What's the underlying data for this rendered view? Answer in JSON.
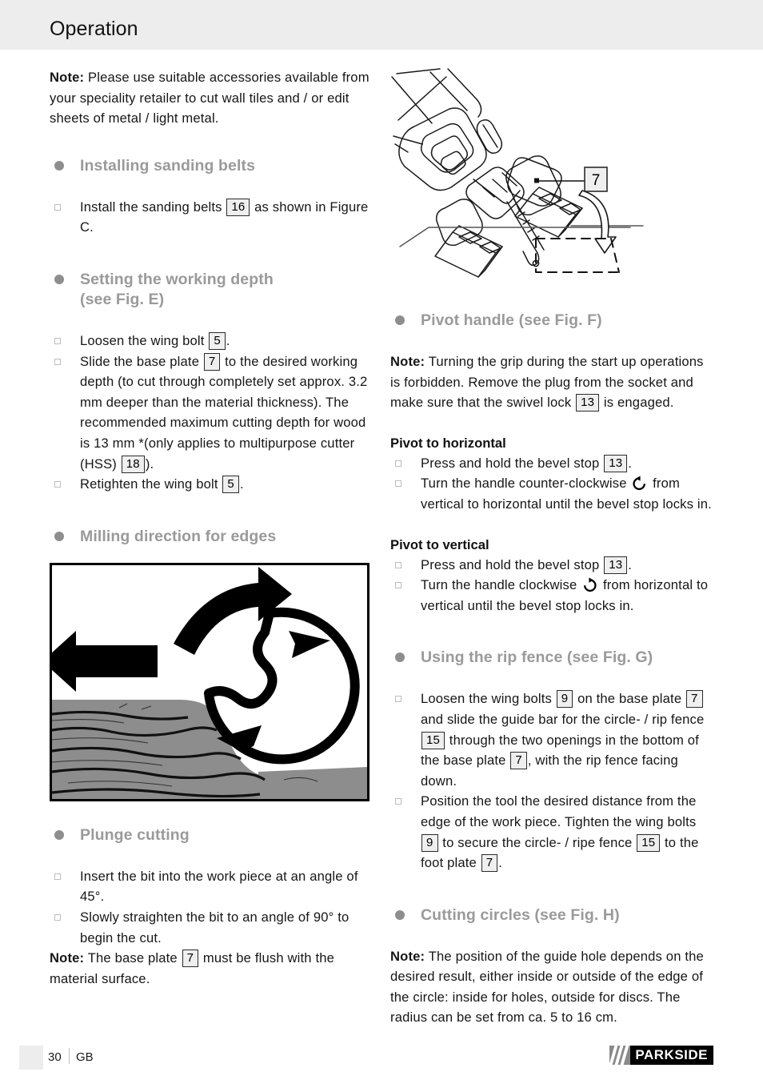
{
  "header": {
    "title": "Operation"
  },
  "colors": {
    "header_band": "#ededed",
    "heading_gray": "#9a9a9a",
    "bullet_gray": "#8e8e8e",
    "ref_box_fill": "#efefef",
    "logo_black": "#000000",
    "logo_gray": "#8a8a8a"
  },
  "left_column": {
    "intro_note": {
      "lead": "Note:",
      "text": " Please use suitable accessories available from your speciality retailer to cut wall tiles and / or edit sheets of metal / light metal."
    },
    "section_installing": {
      "heading": "Installing sanding belts",
      "items": [
        {
          "pre": "Install the sanding belts ",
          "ref": "16",
          "post": " as shown in Figure C."
        }
      ]
    },
    "section_depth": {
      "heading_line1": "Setting the working depth",
      "heading_line2": "(see Fig. E)",
      "items": [
        {
          "pre": "Loosen the wing bolt ",
          "ref": "5",
          "post": "."
        },
        {
          "pre": "Slide the base plate ",
          "ref": "7",
          "mid": " to the desired working depth (to cut through completely set approx. 3.2 mm deeper than the material thickness). The recommended maximum cutting depth for wood is 13 mm *(only applies to multipurpose cutter (HSS) ",
          "ref2": "18",
          "post": ")."
        },
        {
          "pre": "Retighten the wing bolt ",
          "ref": "5",
          "post": "."
        }
      ]
    },
    "section_milling": {
      "heading": "Milling direction for edges",
      "figure_name": "milling-direction-diagram",
      "figure_description": "Wood workpiece with feed arrow pointing left and a rotating cutter with curved clockwise arrows"
    },
    "section_plunge": {
      "heading": "Plunge cutting",
      "items": [
        {
          "text": "Insert the bit into the work piece at an angle of 45°."
        },
        {
          "text": "Slowly straighten the bit to an angle of 90° to begin the cut."
        }
      ],
      "note": {
        "lead": "Note:",
        "pre": " The base plate ",
        "ref": "7",
        "post": " must be flush with the material surface."
      }
    }
  },
  "right_column": {
    "figure_top": {
      "figure_name": "tool-base-plate-diagram",
      "callout": "7",
      "description": "Line drawing of the power tool tilted with base plate callout 7 and a curved down arrow to a dashed outline"
    },
    "section_pivot": {
      "heading": "Pivot handle (see Fig. F)",
      "note": {
        "lead": "Note:",
        "pre": " Turning the grip during the start up operations is forbidden. Remove the plug from the socket and make sure that the swivel lock ",
        "ref": "13",
        "post": " is engaged."
      },
      "horizontal": {
        "subhead": "Pivot to horizontal",
        "items": [
          {
            "pre": "Press and hold the bevel stop ",
            "ref": "13",
            "post": "."
          },
          {
            "pre": "Turn the handle counter-clockwise ",
            "icon": "rotate-counter-clockwise-icon",
            "post": " from vertical to horizontal until the bevel stop locks in."
          }
        ]
      },
      "vertical": {
        "subhead": "Pivot to vertical",
        "items": [
          {
            "pre": "Press and hold the bevel stop ",
            "ref": "13",
            "post": "."
          },
          {
            "pre": "Turn the handle clockwise ",
            "icon": "rotate-clockwise-icon",
            "post": " from horizontal to vertical until the bevel stop locks in."
          }
        ]
      }
    },
    "section_rip_fence": {
      "heading": "Using the rip fence (see Fig. G)",
      "items": [
        {
          "pre": "Loosen the wing bolts ",
          "ref": "9",
          "mid": " on the base plate ",
          "ref2": "7",
          "mid2": " and slide the guide bar for the circle- / rip fence ",
          "ref3": "15",
          "mid3": " through the two openings in the bottom of the base plate ",
          "ref4": "7",
          "post": ", with the rip fence facing down."
        },
        {
          "pre": "Position the tool the desired distance from the edge of the work piece. Tighten the wing bolts ",
          "ref": "9",
          "mid": " to secure the circle- / ripe fence ",
          "ref2": "15",
          "mid2": " to the foot plate ",
          "ref3": "7",
          "post": "."
        }
      ]
    },
    "section_cutting_circles": {
      "heading": "Cutting circles (see Fig. H)",
      "note": {
        "lead": "Note:",
        "text": " The position of the guide hole depends on the desired result, either inside or outside of the edge of the circle: inside for holes, outside for discs. The radius can be set from ca. 5 to 16 cm."
      }
    }
  },
  "footer": {
    "page_number": "30",
    "language": "GB",
    "logo_text": "PARKSIDE"
  }
}
